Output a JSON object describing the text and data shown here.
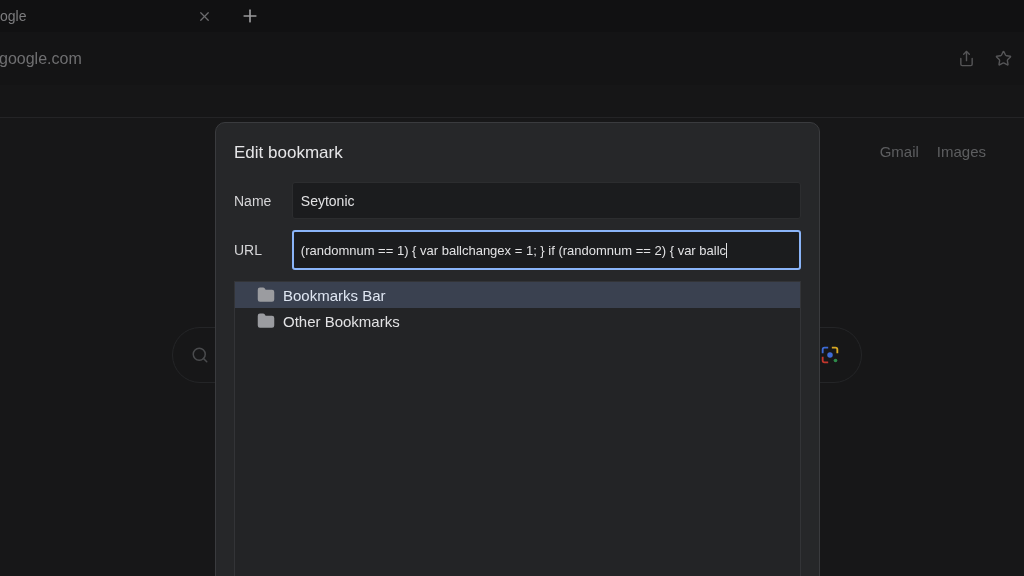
{
  "tab": {
    "title": "ogle"
  },
  "address_bar": {
    "url": "google.com"
  },
  "page": {
    "links": [
      "Gmail",
      "Images"
    ]
  },
  "dialog": {
    "title": "Edit bookmark",
    "fields": [
      {
        "label": "Name",
        "value": "Seytonic",
        "focused": false
      },
      {
        "label": "URL",
        "value": "(randomnum == 1) { var ballchangex = 1; } if (randomnum == 2) { var ballc",
        "focused": true
      }
    ],
    "folders": [
      {
        "name": "Bookmarks Bar",
        "selected": true
      },
      {
        "name": "Other Bookmarks",
        "selected": false
      }
    ]
  }
}
